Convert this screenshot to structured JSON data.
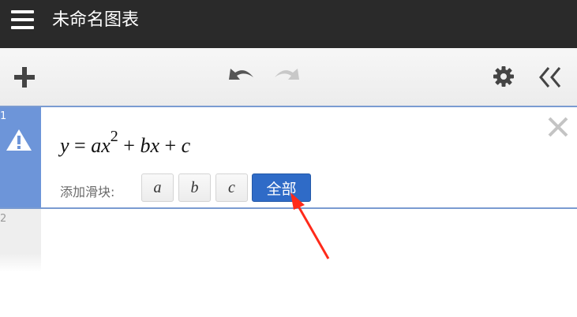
{
  "header": {
    "title": "未命名图表",
    "menu_icon": "hamburger-menu-icon"
  },
  "toolbar": {
    "add_icon": "plus-icon",
    "undo_icon": "undo-icon",
    "redo_icon": "redo-icon",
    "settings_icon": "gear-icon",
    "collapse_icon": "double-chevron-left-icon"
  },
  "expressions": [
    {
      "index": "1",
      "status_icon": "warning-icon",
      "formula": {
        "lhs": "y",
        "eq": "=",
        "a": "a",
        "x": "x",
        "exp": "2",
        "plus1": "+",
        "b": "b",
        "x2": "x",
        "plus2": "+",
        "c": "c"
      },
      "slider_label": "添加滑块:",
      "slider_buttons": [
        "a",
        "b",
        "c"
      ],
      "all_button": "全部",
      "delete_icon": "close-x-icon"
    },
    {
      "index": "2"
    }
  ],
  "colors": {
    "titlebar": "#2a2a2a",
    "selected_gutter": "#6d95d9",
    "primary_button": "#2f6bc7",
    "annotation_arrow": "#ff2a1a"
  }
}
